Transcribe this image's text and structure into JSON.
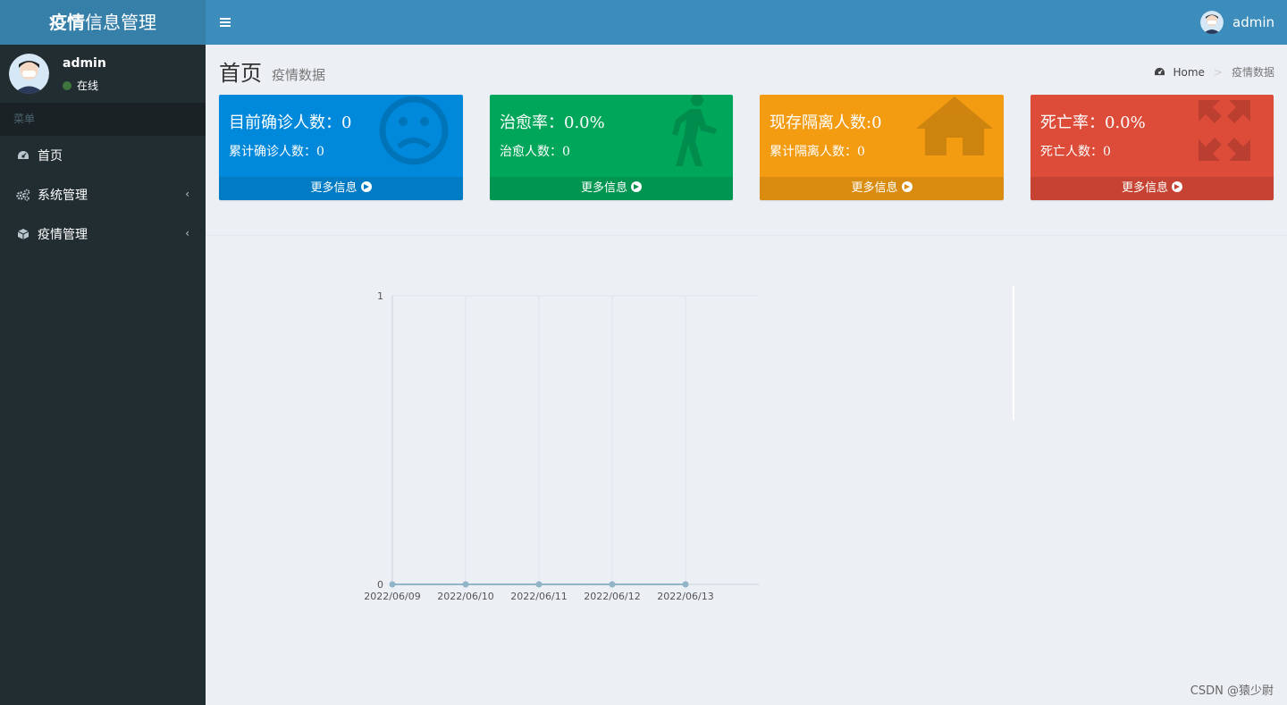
{
  "header": {
    "logo_bold": "疫情",
    "logo_rest": "信息管理",
    "user_name": "admin"
  },
  "sidebar": {
    "user_name": "admin",
    "status": "在线",
    "menu_header": "菜单",
    "items": [
      {
        "label": "首页",
        "icon": "dashboard-icon"
      },
      {
        "label": "系统管理",
        "icon": "gears-icon"
      },
      {
        "label": "疫情管理",
        "icon": "cube-icon"
      }
    ]
  },
  "content": {
    "title": "首页",
    "subtitle": "疫情数据",
    "breadcrumb": {
      "home": "Home",
      "current": "疫情数据"
    }
  },
  "cards": [
    {
      "title": "目前确诊人数：0",
      "sub": "累计确诊人数：0",
      "more": "更多信息",
      "color": "#0089db",
      "icon": "frown-icon"
    },
    {
      "title": "治愈率：0.0%",
      "sub": "治愈人数：0",
      "more": "更多信息",
      "color": "#00a65a",
      "icon": "walking-person-icon"
    },
    {
      "title": "现存隔离人数:0",
      "sub": "累计隔离人数：0",
      "more": "更多信息",
      "color": "#f39c12",
      "icon": "home-icon"
    },
    {
      "title": "死亡率：0.0%",
      "sub": "死亡人数：0",
      "more": "更多信息",
      "color": "#dd4b39",
      "icon": "expand-arrows-icon"
    }
  ],
  "chart_data": {
    "type": "line",
    "categories": [
      "2022/06/09",
      "2022/06/10",
      "2022/06/11",
      "2022/06/12",
      "2022/06/13"
    ],
    "series": [
      {
        "values": [
          0,
          0,
          0,
          0,
          0
        ],
        "color": "#91b4c8"
      }
    ],
    "ylim": [
      0,
      1
    ],
    "yticks": [
      "0",
      "1"
    ],
    "grid": true
  },
  "watermark": "CSDN @猿少尉"
}
